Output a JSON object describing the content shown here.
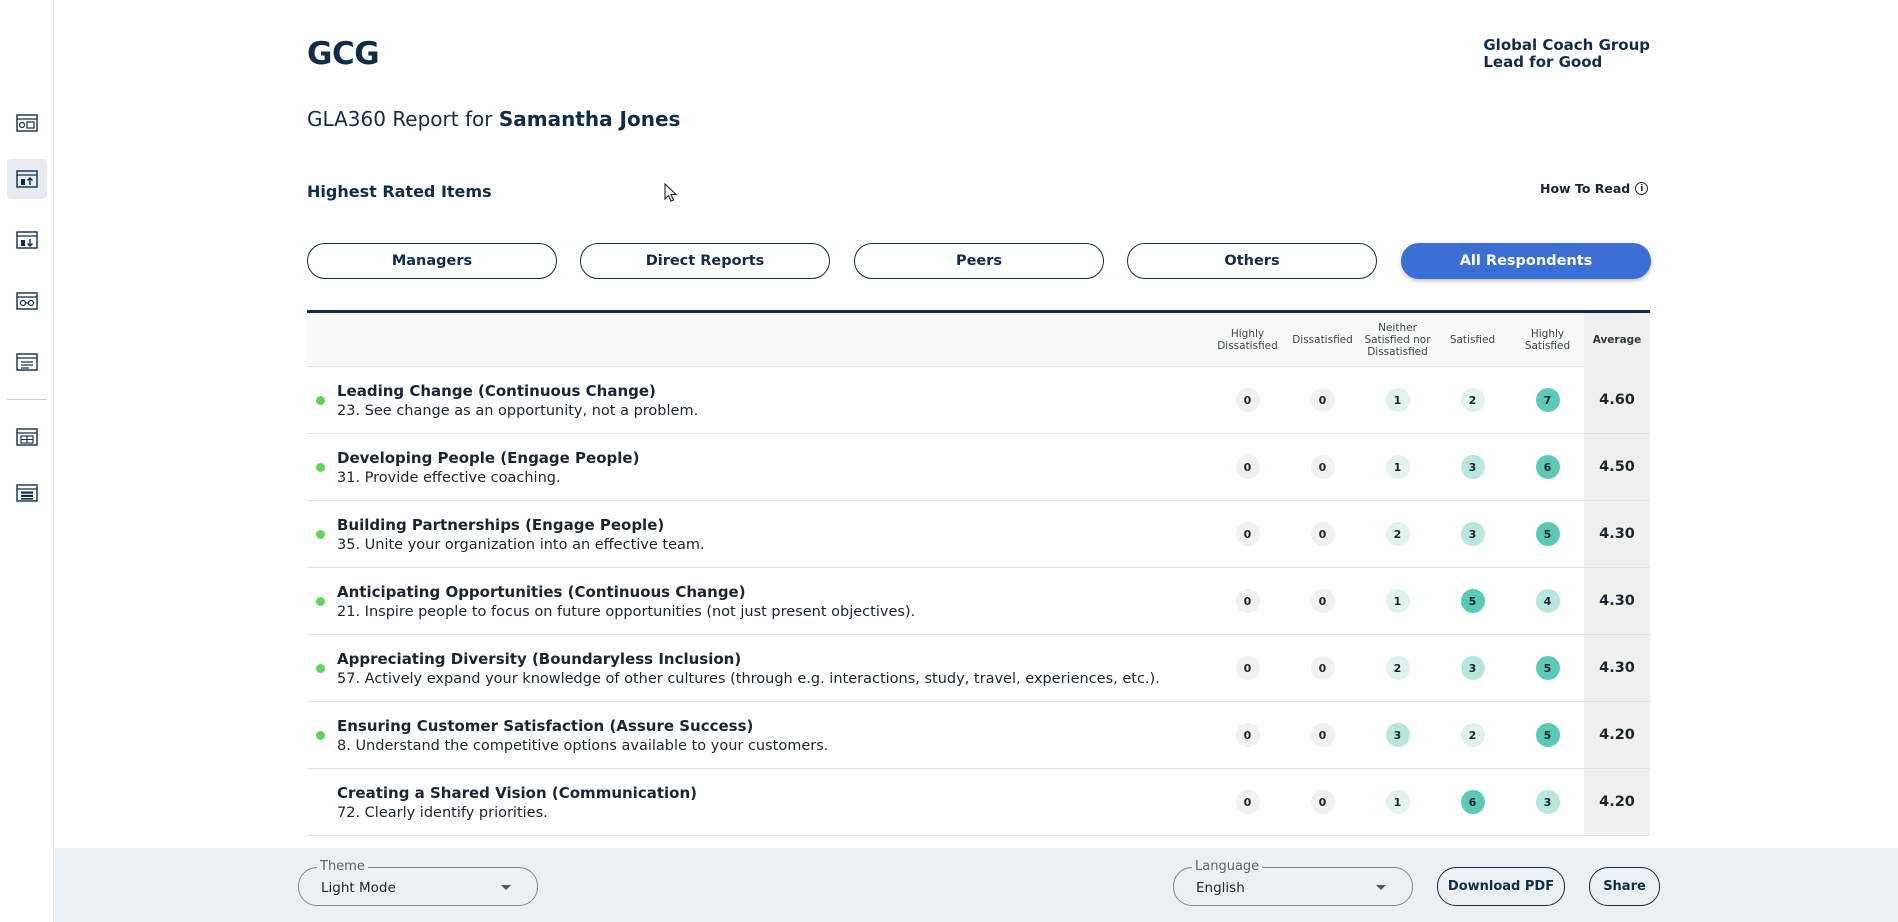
{
  "brand": {
    "logo": "GCG",
    "company": "Global Coach Group",
    "tagline": "Lead for Good"
  },
  "report": {
    "title_prefix": "GLA360 Report for",
    "person": "Samantha Jones"
  },
  "section": {
    "title": "Highest Rated Items",
    "how_to_read": "How To Read"
  },
  "tabs": [
    {
      "label": "Managers",
      "active": false
    },
    {
      "label": "Direct Reports",
      "active": false
    },
    {
      "label": "Peers",
      "active": false
    },
    {
      "label": "Others",
      "active": false
    },
    {
      "label": "All Respondents",
      "active": true
    }
  ],
  "table": {
    "columns": [
      "Highly Dissatisfied",
      "Dissatisfied",
      "Neither Satisfied nor Dissatisfied",
      "Satisfied",
      "Highly Satisfied",
      "Average"
    ],
    "rows": [
      {
        "title": "Leading Change (Continuous Change)",
        "desc": "23. See change as an opportunity, not a problem.",
        "dot": true,
        "counts": [
          "0",
          "0",
          "1",
          "2",
          "7"
        ],
        "average": "4.60"
      },
      {
        "title": "Developing People (Engage People)",
        "desc": "31. Provide effective coaching.",
        "dot": true,
        "counts": [
          "0",
          "0",
          "1",
          "3",
          "6"
        ],
        "average": "4.50"
      },
      {
        "title": "Building Partnerships (Engage People)",
        "desc": "35. Unite your organization into an effective team.",
        "dot": true,
        "counts": [
          "0",
          "0",
          "2",
          "3",
          "5"
        ],
        "average": "4.30"
      },
      {
        "title": "Anticipating Opportunities (Continuous Change)",
        "desc": "21. Inspire people to focus on future opportunities (not just present objectives).",
        "dot": true,
        "counts": [
          "0",
          "0",
          "1",
          "5",
          "4"
        ],
        "average": "4.30"
      },
      {
        "title": "Appreciating Diversity (Boundaryless Inclusion)",
        "desc": "57. Actively expand your knowledge of other cultures (through e.g. interactions, study, travel, experiences, etc.).",
        "dot": true,
        "counts": [
          "0",
          "0",
          "2",
          "3",
          "5"
        ],
        "average": "4.30"
      },
      {
        "title": "Ensuring Customer Satisfaction (Assure Success)",
        "desc": "8. Understand the competitive options available to your customers.",
        "dot": true,
        "counts": [
          "0",
          "0",
          "3",
          "2",
          "5"
        ],
        "average": "4.20"
      },
      {
        "title": "Creating a Shared Vision (Communication)",
        "desc": "72. Clearly identify priorities.",
        "dot": false,
        "counts": [
          "0",
          "0",
          "1",
          "6",
          "3"
        ],
        "average": "4.20"
      }
    ]
  },
  "footer": {
    "theme_label": "Theme",
    "theme_value": "Light Mode",
    "language_label": "Language",
    "language_value": "English",
    "download_label": "Download PDF",
    "share_label": "Share"
  },
  "colors": {
    "navy": "#0f2d4a",
    "accent": "#3b6fd4",
    "dot_green": "#5fd35c",
    "badge_zero": "#f1f1ef",
    "badge_low": "#e0f3ef",
    "badge_mid": "#b7e7dd",
    "badge_high": "#5cc9b6"
  }
}
